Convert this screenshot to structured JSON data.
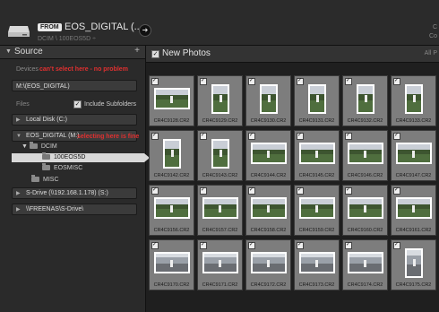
{
  "topbar": {
    "from_badge": "FROM",
    "source_title": "EOS_DIGITAL (...",
    "source_path": "DCIM \\ 100EOS5D ÷",
    "go_arrow": "➜",
    "right_line1": "C",
    "right_line2": "Co"
  },
  "left_panel": {
    "header_label": "Source",
    "header_plus": "+",
    "devices_label": "Devices",
    "annotation_devices": "can't select here - no problem",
    "device_field": "M:\\(EOS_DIGITAL)",
    "files_label": "Files",
    "include_subfolders_label": "Include Subfolders",
    "local_disk": "Local Disk (C:)",
    "eos_digital": "EOS_DIGITAL (M:)",
    "annotation_select": "selecting here is fine",
    "tree": [
      "DCIM",
      "100EOS5D",
      "EOSMISC",
      "MISC"
    ],
    "s_drive": "S-Drive (\\\\192.168.1.178) (S:)",
    "freenas": "\\\\FREENAS\\S-Drive\\"
  },
  "grid": {
    "header_title": "New Photos",
    "header_right": "All P",
    "rows": [
      [
        "CR4C9128.CR2",
        "CR4C9129.CR2",
        "CR4C9130.CR2",
        "CR4C9131.CR2",
        "CR4C9132.CR2",
        "CR4C9133.CR2"
      ],
      [
        "CR4C9142.CR2",
        "CR4C9143.CR2",
        "CR4C9144.CR2",
        "CR4C9145.CR2",
        "CR4C9146.CR2",
        "CR4C9147.CR2"
      ],
      [
        "CR4C9156.CR2",
        "CR4C9157.CR2",
        "CR4C9158.CR2",
        "CR4C9159.CR2",
        "CR4C9160.CR2",
        "CR4C9161.CR2"
      ],
      [
        "CR4C9170.CR2",
        "CR4C9171.CR2",
        "CR4C9172.CR2",
        "CR4C9173.CR2",
        "CR4C9174.CR2",
        "CR4C9175.CR2"
      ]
    ],
    "orientations": [
      [
        "land",
        "portrait",
        "portrait",
        "portrait",
        "portrait",
        "portrait"
      ],
      [
        "portrait",
        "portrait",
        "land",
        "land",
        "land",
        "land"
      ],
      [
        "land",
        "land",
        "land",
        "land",
        "land",
        "land"
      ],
      [
        "land",
        "land",
        "land",
        "land",
        "land",
        "portrait"
      ]
    ]
  }
}
